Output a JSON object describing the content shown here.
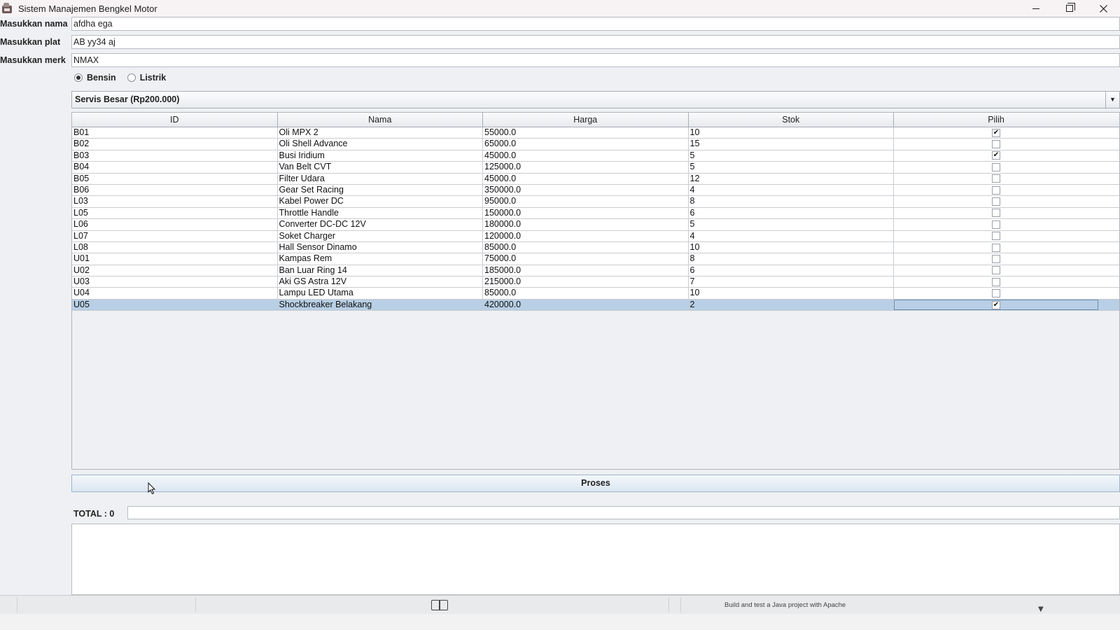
{
  "window": {
    "title": "Sistem Manajemen Bengkel Motor",
    "controls": {
      "minimize": "minimize-icon",
      "maximize": "restore-icon",
      "close": "close-icon"
    }
  },
  "form": {
    "name_label": "Masukkan nama",
    "name_value": "afdha ega",
    "plate_label": "Masukkan plat",
    "plate_value": "AB yy34 aj",
    "brand_label": "Masukkan merk",
    "brand_value": "NMAX"
  },
  "fuel": {
    "options": [
      {
        "label": "Bensin",
        "checked": true
      },
      {
        "label": "Listrik",
        "checked": false
      }
    ]
  },
  "service_combo": {
    "selected": "Servis Besar (Rp200.000)"
  },
  "table": {
    "headers": [
      "ID",
      "Nama",
      "Harga",
      "Stok",
      "Pilih"
    ],
    "rows": [
      {
        "id": "B01",
        "nama": "Oli MPX 2",
        "harga": "55000.0",
        "stok": "10",
        "pilih": true
      },
      {
        "id": "B02",
        "nama": "Oli Shell Advance",
        "harga": "65000.0",
        "stok": "15",
        "pilih": false
      },
      {
        "id": "B03",
        "nama": "Busi Iridium",
        "harga": "45000.0",
        "stok": "5",
        "pilih": true
      },
      {
        "id": "B04",
        "nama": "Van Belt CVT",
        "harga": "125000.0",
        "stok": "5",
        "pilih": false
      },
      {
        "id": "B05",
        "nama": "Filter Udara",
        "harga": "45000.0",
        "stok": "12",
        "pilih": false
      },
      {
        "id": "B06",
        "nama": "Gear Set Racing",
        "harga": "350000.0",
        "stok": "4",
        "pilih": false
      },
      {
        "id": "L03",
        "nama": "Kabel Power DC",
        "harga": "95000.0",
        "stok": "8",
        "pilih": false
      },
      {
        "id": "L05",
        "nama": "Throttle Handle",
        "harga": "150000.0",
        "stok": "6",
        "pilih": false
      },
      {
        "id": "L06",
        "nama": "Converter DC-DC 12V",
        "harga": "180000.0",
        "stok": "5",
        "pilih": false
      },
      {
        "id": "L07",
        "nama": "Soket Charger",
        "harga": "120000.0",
        "stok": "4",
        "pilih": false
      },
      {
        "id": "L08",
        "nama": "Hall Sensor Dinamo",
        "harga": "85000.0",
        "stok": "10",
        "pilih": false
      },
      {
        "id": "U01",
        "nama": "Kampas Rem",
        "harga": "75000.0",
        "stok": "8",
        "pilih": false
      },
      {
        "id": "U02",
        "nama": "Ban Luar Ring 14",
        "harga": "185000.0",
        "stok": "6",
        "pilih": false
      },
      {
        "id": "U03",
        "nama": "Aki GS Astra 12V",
        "harga": "215000.0",
        "stok": "7",
        "pilih": false
      },
      {
        "id": "U04",
        "nama": "Lampu LED Utama",
        "harga": "85000.0",
        "stok": "10",
        "pilih": false
      },
      {
        "id": "U05",
        "nama": "Shockbreaker Belakang",
        "harga": "420000.0",
        "stok": "2",
        "pilih": true,
        "selected": true
      }
    ]
  },
  "actions": {
    "process_label": "Proses"
  },
  "total": {
    "label": "TOTAL : 0",
    "value": ""
  },
  "output": {
    "text": ""
  },
  "taskbar": {
    "icon": "book-icon",
    "note": "Build and test a Java project with Apache"
  }
}
